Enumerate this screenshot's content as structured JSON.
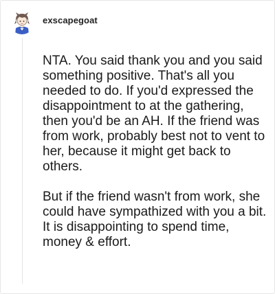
{
  "comment": {
    "author": {
      "username": "exscapegoat",
      "avatar_icon": "cartoon-avatar-icon"
    },
    "paragraphs": [
      "NTA. You said thank you and you said something positive. That's all you needed to do. If you'd expressed the disappointment to at the gathering, then you'd be an AH. If the friend was from work, probably best not to vent to her, because it might get back to others.",
      "But if the friend wasn't from work, she could have sympathized with you a bit. It is disappointing to spend time, money & effort."
    ]
  },
  "colors": {
    "card_border": "#e6e6e6",
    "thread_line": "#e3e3e3",
    "text": "#1a1a1a",
    "avatar_shirt": "#3b5fc7"
  }
}
